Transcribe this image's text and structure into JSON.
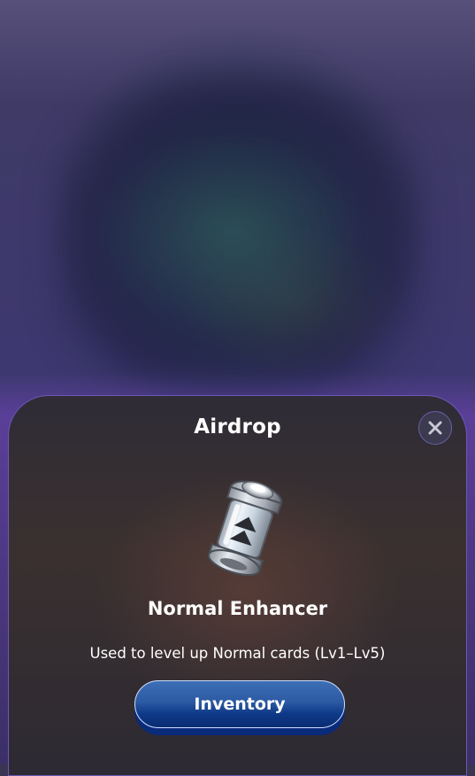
{
  "modal": {
    "title": "Airdrop",
    "item_name": "Normal Enhancer",
    "item_description": "Used to level up Normal cards (Lv1–Lv5)",
    "primary_button_label": "Inventory",
    "close_icon": "close-icon",
    "item_icon": "enhancer-capsule-icon"
  },
  "colors": {
    "sheet_border": "#6b58b8",
    "button_blue": "#2c5aa3",
    "button_shadow": "#0a2a7a",
    "text": "#ffffff"
  }
}
